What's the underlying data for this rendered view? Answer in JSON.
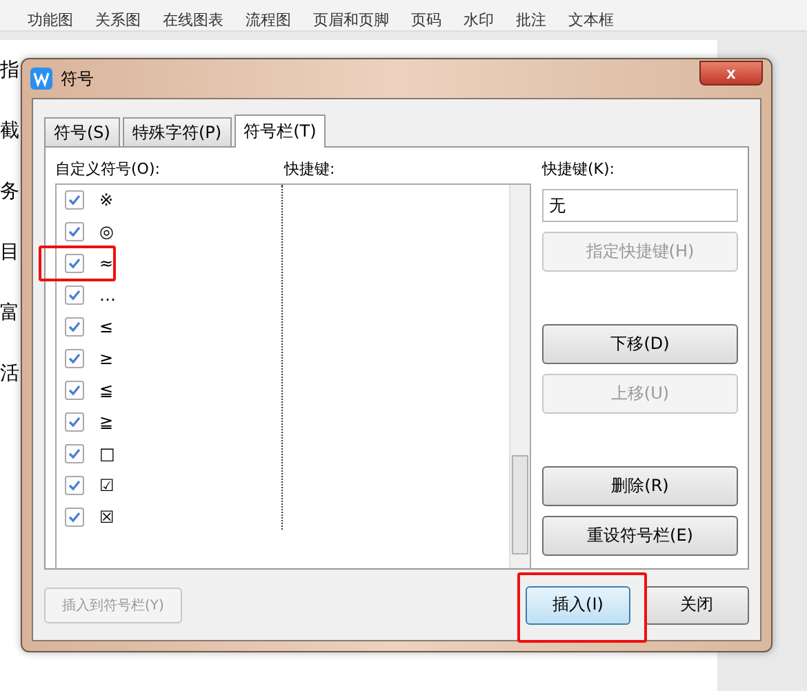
{
  "toolbar": {
    "items": [
      "功能图",
      "关系图",
      "在线图表",
      "流程图",
      "页眉和页脚",
      "页码",
      "水印",
      "批注",
      "文本框"
    ]
  },
  "document": {
    "lines": [
      "指",
      "截",
      "务",
      "目",
      "富",
      "活"
    ]
  },
  "dialog": {
    "title": "符号",
    "close": "x",
    "tabs": [
      {
        "label": "符号(S)",
        "selected": false
      },
      {
        "label": "特殊字符(P)",
        "selected": false
      },
      {
        "label": "符号栏(T)",
        "selected": true
      }
    ],
    "list_label": "自定义符号(O):",
    "shortcut_column": "快捷键:",
    "symbols": [
      {
        "symbol": "※",
        "checked": true
      },
      {
        "symbol": "◎",
        "checked": true
      },
      {
        "symbol": "≈",
        "checked": true
      },
      {
        "symbol": "…",
        "checked": true
      },
      {
        "symbol": "≤",
        "checked": true
      },
      {
        "symbol": "≥",
        "checked": true
      },
      {
        "symbol": "≦",
        "checked": true
      },
      {
        "symbol": "≧",
        "checked": true
      },
      {
        "symbol": "□",
        "checked": true
      },
      {
        "symbol": "☑",
        "checked": true
      },
      {
        "symbol": "☒",
        "checked": true
      }
    ],
    "shortcut_label": "快捷键(K):",
    "shortcut_value": "无",
    "buttons": [
      {
        "label": "指定快捷键(H)",
        "disabled": true,
        "gap_before": false
      },
      {
        "label": "下移(D)",
        "disabled": false,
        "gap_before": true
      },
      {
        "label": "上移(U)",
        "disabled": true,
        "gap_before": false
      },
      {
        "label": "删除(R)",
        "disabled": false,
        "gap_before": true
      },
      {
        "label": "重设符号栏(E)",
        "disabled": false,
        "gap_before": false
      }
    ],
    "footer_left": {
      "label": "插入到符号栏(Y)",
      "disabled": true
    },
    "footer_buttons": [
      {
        "label": "插入(I)",
        "primary": true
      },
      {
        "label": "关闭",
        "primary": false
      }
    ]
  }
}
